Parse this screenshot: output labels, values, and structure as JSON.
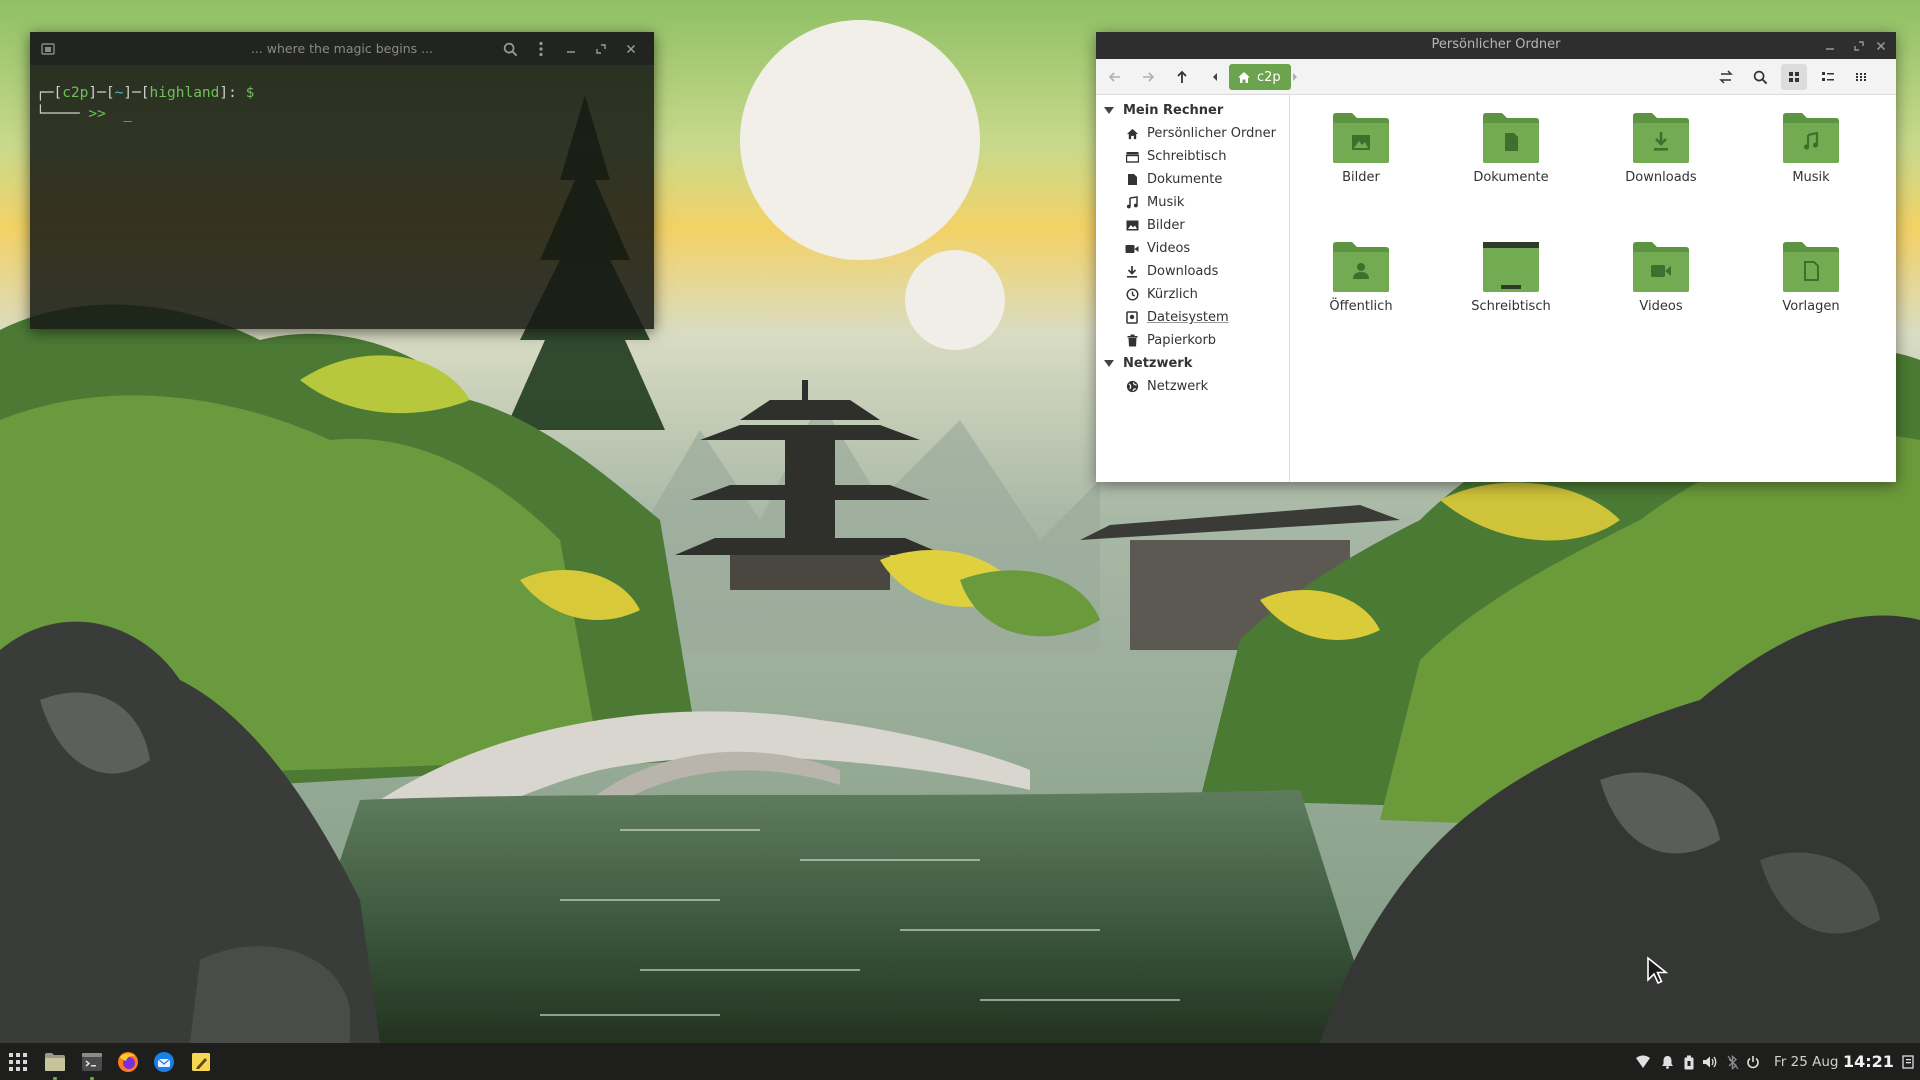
{
  "terminal": {
    "title": "... where the magic begins ...",
    "prompt": {
      "open1": "┌─[",
      "user": "c2p",
      "sep1": "]─[",
      "path": "~",
      "sep2": "]─[",
      "host": "highland",
      "close": "]: ",
      "dollar": "$",
      "line2_prefix": "└──── ",
      "line2_arrows": ">>",
      "cursor": "_"
    }
  },
  "filemanager": {
    "title": "Persönlicher Ordner",
    "breadcrumb": "c2p",
    "sidebar": {
      "section1": "Mein Rechner",
      "items1": [
        {
          "label": "Persönlicher Ordner",
          "icon": "home-icon"
        },
        {
          "label": "Schreibtisch",
          "icon": "desktop-icon"
        },
        {
          "label": "Dokumente",
          "icon": "document-icon"
        },
        {
          "label": "Musik",
          "icon": "music-icon"
        },
        {
          "label": "Bilder",
          "icon": "picture-icon"
        },
        {
          "label": "Videos",
          "icon": "video-icon"
        },
        {
          "label": "Downloads",
          "icon": "download-icon"
        },
        {
          "label": "Kürzlich",
          "icon": "clock-icon"
        },
        {
          "label": "Dateisystem",
          "icon": "drive-icon"
        },
        {
          "label": "Papierkorb",
          "icon": "trash-icon"
        }
      ],
      "section2": "Netzwerk",
      "items2": [
        {
          "label": "Netzwerk",
          "icon": "network-icon"
        }
      ]
    },
    "folders": [
      {
        "name": "Bilder",
        "icon": "picture-folder-icon"
      },
      {
        "name": "Dokumente",
        "icon": "document-folder-icon"
      },
      {
        "name": "Downloads",
        "icon": "download-folder-icon"
      },
      {
        "name": "Musik",
        "icon": "music-folder-icon"
      },
      {
        "name": "Öffentlich",
        "icon": "public-folder-icon"
      },
      {
        "name": "Schreibtisch",
        "icon": "desktop-folder-icon"
      },
      {
        "name": "Videos",
        "icon": "video-folder-icon"
      },
      {
        "name": "Vorlagen",
        "icon": "template-folder-icon"
      }
    ],
    "accent": "#6ca34d"
  },
  "taskbar": {
    "date": "Fr 25 Aug",
    "time": "14:21"
  }
}
